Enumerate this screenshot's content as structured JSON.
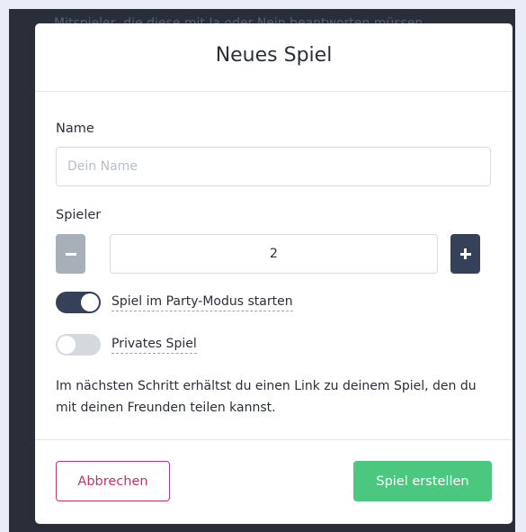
{
  "background": {
    "text": "Mitspieler, die diese mit Ja oder Nein beantworten müssen."
  },
  "modal": {
    "title": "Neues Spiel",
    "name_label": "Name",
    "name_placeholder": "Dein Name",
    "name_value": "",
    "players_label": "Spieler",
    "players_count": "2",
    "party_mode": {
      "label": "Spiel im Party-Modus starten",
      "enabled": true
    },
    "private_game": {
      "label": "Privates Spiel",
      "enabled": false
    },
    "info_text": "Im nächsten Schritt erhältst du einen Link zu deinem Spiel, den du mit deinen Freunden teilen kannst.",
    "cancel_label": "Abbrechen",
    "create_label": "Spiel erstellen"
  },
  "colors": {
    "accent_dark": "#354158",
    "cancel": "#c4346a",
    "create": "#4cc77f"
  },
  "icons": {
    "decrement": "minus-icon",
    "increment": "plus-icon"
  }
}
